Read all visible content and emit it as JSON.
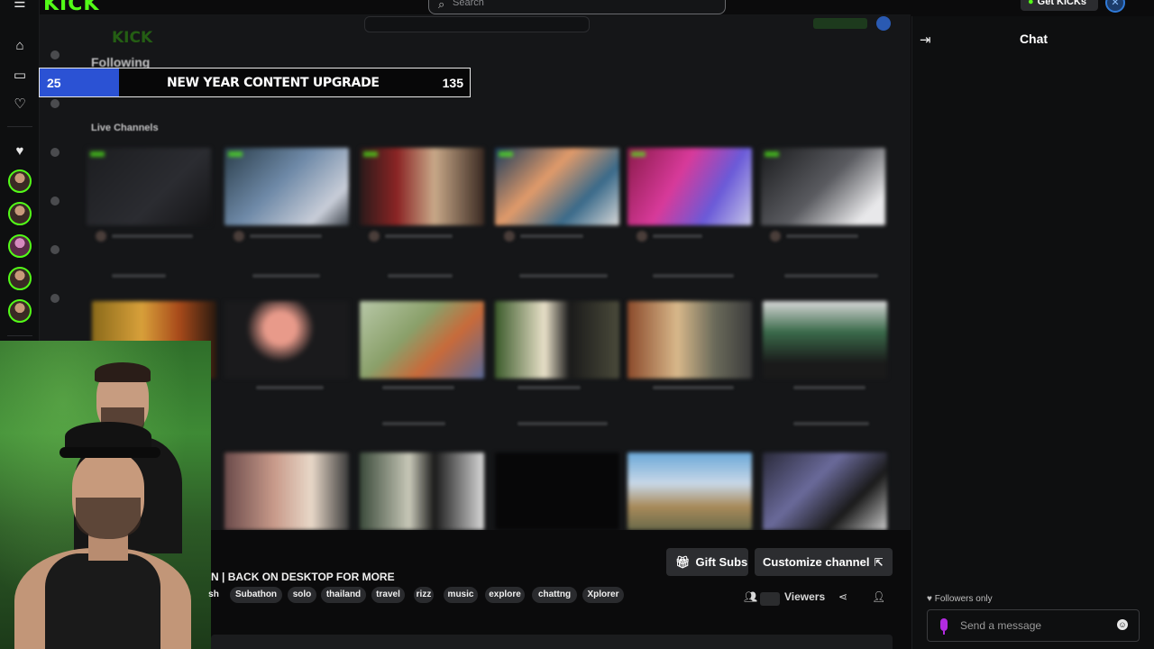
{
  "brand": {
    "logo": "KICK",
    "accent": "#53fc18"
  },
  "header": {
    "search_placeholder": "Search",
    "get_kicks_label": "Get KICKs"
  },
  "sidebar": {
    "icons": [
      "home-icon",
      "browse-icon",
      "heart-icon",
      "heart-icon",
      "live-icon"
    ]
  },
  "goal": {
    "current": "25",
    "title": "NEW YEAR CONTENT UPGRADE",
    "target": "135",
    "progress_fraction": 0.185,
    "fill_color": "#2b52d4"
  },
  "browser_bg": {
    "following_heading": "Following",
    "live_channels_heading": "Live Channels"
  },
  "stream": {
    "title_visible": "N | BACK ON DESKTOP FOR MORE",
    "tags_partial_first": "sh",
    "tags": [
      "Subathon",
      "solo",
      "thailand",
      "travel",
      "rizz",
      "music",
      "explore",
      "chattng",
      "Xplorer"
    ],
    "gift_subs_label": "Gift Subs",
    "customize_label": "Customize channel",
    "viewers_label": "Viewers"
  },
  "chat": {
    "title": "Chat",
    "followers_only_label": "Followers only",
    "input_placeholder": "Send a message"
  }
}
